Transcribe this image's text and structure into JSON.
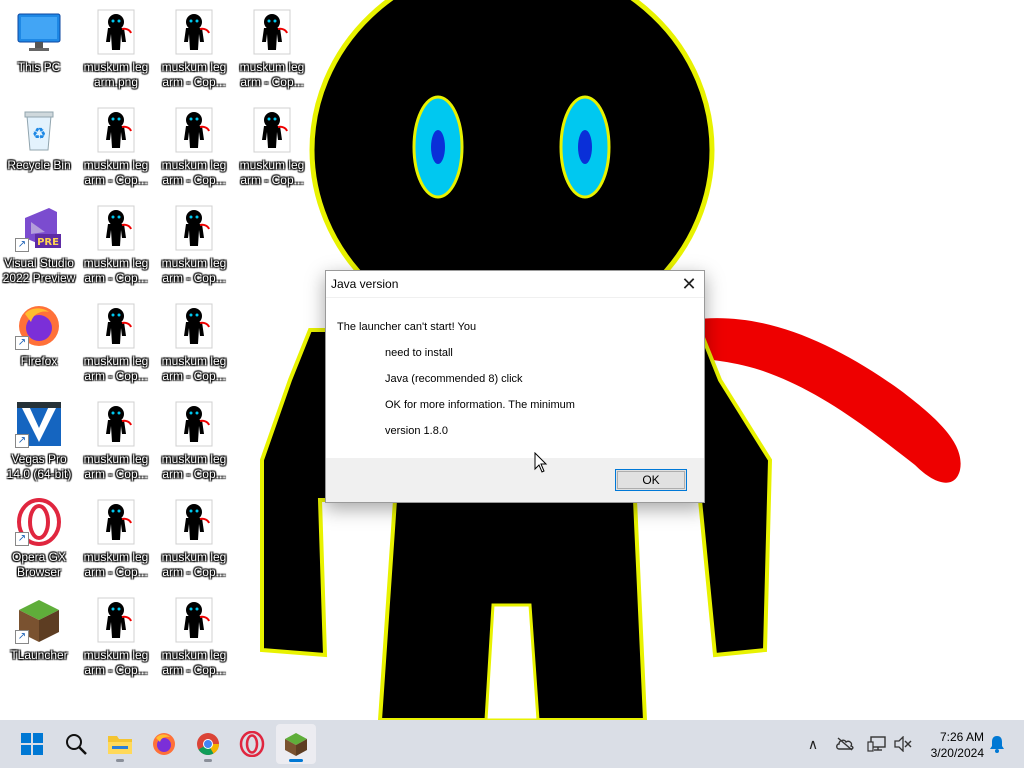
{
  "desktop": {
    "system_icons": [
      {
        "label": "This PC",
        "icon": "monitor-icon"
      },
      {
        "label": "Recycle Bin",
        "icon": "recycle-bin-icon"
      },
      {
        "label": "Visual Studio 2022 Preview",
        "icon": "visual-studio-preview-icon",
        "badge": "PRE"
      },
      {
        "label": "Firefox",
        "icon": "firefox-icon"
      },
      {
        "label": "Vegas Pro 14.0 (64-bit)",
        "icon": "vegas-pro-icon"
      },
      {
        "label": "Opera GX Browser",
        "icon": "opera-gx-icon"
      },
      {
        "label": "TLauncher",
        "icon": "tlauncher-icon"
      }
    ],
    "file_icons": [
      {
        "label": "muskum leg arm.png"
      },
      {
        "label": "muskum leg arm - Cop..."
      },
      {
        "label": "muskum leg arm - Cop..."
      },
      {
        "label": "muskum leg arm - Cop..."
      },
      {
        "label": "muskum leg arm - Cop..."
      },
      {
        "label": "muskum leg arm - Cop..."
      },
      {
        "label": "muskum leg arm - Cop..."
      },
      {
        "label": "muskum leg arm - Cop..."
      },
      {
        "label": "muskum leg arm - Cop..."
      },
      {
        "label": "muskum leg arm - Cop..."
      },
      {
        "label": "muskum leg arm - Cop..."
      },
      {
        "label": "muskum leg arm - Cop..."
      },
      {
        "label": "muskum leg arm - Cop..."
      },
      {
        "label": "muskum leg arm - Cop..."
      },
      {
        "label": "muskum leg arm - Cop..."
      },
      {
        "label": "muskum leg arm - Cop..."
      }
    ]
  },
  "dialog": {
    "title": "Java version",
    "close_glyph": "✕",
    "lines": [
      "The launcher can't start! You",
      "need to install",
      "Java (recommended 8) click",
      "OK for more information. The minimum",
      "version 1.8.0"
    ],
    "ok_label": "OK"
  },
  "taskbar": {
    "apps": [
      {
        "name": "start-button",
        "icon": "windows-start-icon"
      },
      {
        "name": "search-button",
        "icon": "search-icon"
      },
      {
        "name": "file-explorer-button",
        "icon": "folder-icon"
      },
      {
        "name": "firefox-button",
        "icon": "firefox-icon"
      },
      {
        "name": "chrome-button",
        "icon": "chrome-icon"
      },
      {
        "name": "opera-gx-button",
        "icon": "opera-gx-icon"
      },
      {
        "name": "tlauncher-button",
        "icon": "tlauncher-icon"
      }
    ],
    "tray_glyphs": {
      "chevron": "∧"
    },
    "clock": {
      "time": "7:26 AM",
      "date": "3/20/2024"
    }
  },
  "colors": {
    "wallpaper_bg": "#ffffff",
    "figure": "#000000",
    "outline": "#e8f200",
    "eye_outer": "#00c8f0",
    "eye_inner": "#0a2fd8",
    "scarf": "#ee0000",
    "taskbar_bg": "#dadee6",
    "accent": "#0078d7"
  }
}
